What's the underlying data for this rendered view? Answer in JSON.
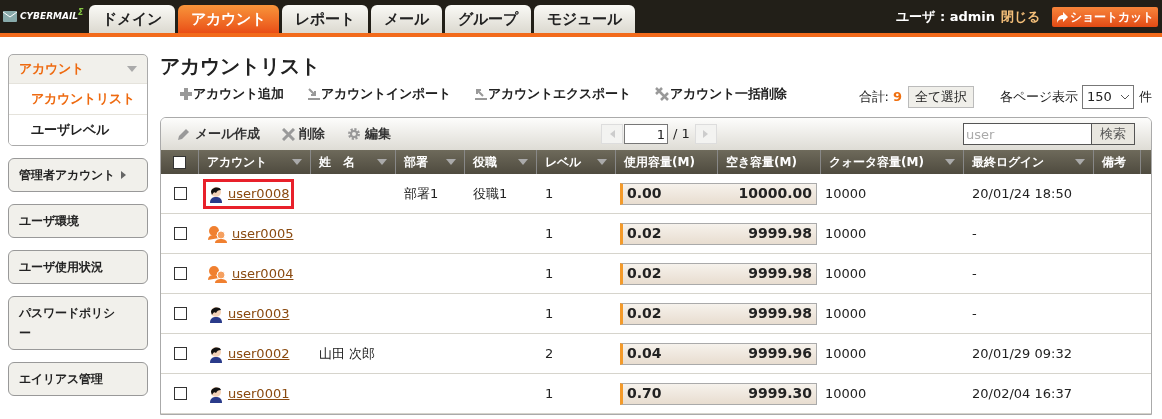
{
  "header": {
    "logo": "CYBERMAIL",
    "logo_mark": "Σ",
    "tabs": [
      {
        "label": "ドメイン",
        "selected": false
      },
      {
        "label": "アカウント",
        "selected": true
      },
      {
        "label": "レポート",
        "selected": false
      },
      {
        "label": "メール",
        "selected": false
      },
      {
        "label": "グループ",
        "selected": false
      },
      {
        "label": "モジュール",
        "selected": false
      }
    ],
    "user_label": "ユーザ : admin",
    "logout": "閉じる",
    "shortcut": "ショートカット"
  },
  "sidebar": [
    {
      "label": "アカウント",
      "kind": "open",
      "children": [
        {
          "label": "アカウントリスト",
          "selected": true
        },
        {
          "label": "ユーザレベル",
          "selected": false
        }
      ]
    },
    {
      "label": "管理者アカウント",
      "kind": "submenu"
    },
    {
      "label": "ユーザ環境",
      "kind": "plain"
    },
    {
      "label": "ユーザ使用状況",
      "kind": "plain"
    },
    {
      "label": "パスワードポリシー",
      "kind": "plain"
    },
    {
      "label": "エイリアス管理",
      "kind": "plain"
    }
  ],
  "title": "アカウントリスト",
  "actions": [
    {
      "label": "アカウント追加",
      "kind": "add"
    },
    {
      "label": "アカウントインポート",
      "kind": "import"
    },
    {
      "label": "アカウントエクスポート",
      "kind": "export"
    },
    {
      "label": "アカウント一括削除",
      "kind": "bulk"
    }
  ],
  "total_label": "合計:",
  "total": "9",
  "select_all": "全て選択",
  "per_page_label": "各ページ表示",
  "per_page": "150",
  "per_page_unit": "件",
  "toolbar": [
    {
      "label": "メール作成",
      "kind": "pencil"
    },
    {
      "label": "削除",
      "kind": "delete"
    },
    {
      "label": "編集",
      "kind": "gear"
    }
  ],
  "page": "1",
  "page_total": "/ 1",
  "search_value": "user",
  "search_button": "検索",
  "table": {
    "all_checked": false,
    "columns": [
      {
        "label": "アカウント",
        "sortable": true
      },
      {
        "label": "姓　名",
        "sortable": true
      },
      {
        "label": "部署",
        "sortable": true
      },
      {
        "label": "役職",
        "sortable": true
      },
      {
        "label": "レベル",
        "sortable": true
      },
      {
        "label": "使用容量(M)",
        "sortable": false
      },
      {
        "label": "空き容量(M)",
        "sortable": false
      },
      {
        "label": "クォータ容量(M)",
        "sortable": true
      },
      {
        "label": "最終ログイン",
        "sortable": true
      },
      {
        "label": "備考",
        "sortable": false
      }
    ],
    "rows": [
      {
        "checked": false,
        "kind": "user",
        "highlighted": true,
        "account": "user0008",
        "name": "",
        "dept": "部署1",
        "post": "役職1",
        "level_text": "1",
        "used": "0.00",
        "free": "10000.00",
        "quota": "10000",
        "last_login": "20/01/24 18:50"
      },
      {
        "checked": false,
        "kind": "group",
        "highlighted": false,
        "account": "user0005",
        "name": "",
        "dept": "",
        "post": "",
        "level_text": "1",
        "used": "0.02",
        "free": "9999.98",
        "quota": "10000",
        "last_login": "-"
      },
      {
        "checked": false,
        "kind": "group",
        "highlighted": false,
        "account": "user0004",
        "name": "",
        "dept": "",
        "post": "",
        "level_text": "1",
        "used": "0.02",
        "free": "9999.98",
        "quota": "10000",
        "last_login": "-"
      },
      {
        "checked": false,
        "kind": "user",
        "highlighted": false,
        "account": "user0003",
        "name": "",
        "dept": "",
        "post": "",
        "level_text": "1",
        "used": "0.02",
        "free": "9999.98",
        "quota": "10000",
        "last_login": "-"
      },
      {
        "checked": false,
        "kind": "user",
        "highlighted": false,
        "account": "user0002",
        "name": "山田 次郎",
        "dept": "",
        "post": "",
        "level_text": "2",
        "used": "0.04",
        "free": "9999.96",
        "quota": "10000",
        "last_login": "20/01/29 09:32"
      },
      {
        "checked": false,
        "kind": "user",
        "highlighted": false,
        "account": "user0001",
        "name": "",
        "dept": "",
        "post": "",
        "level_text": "1",
        "used": "0.70",
        "free": "9999.30",
        "quota": "10000",
        "last_login": "20/02/04 16:37"
      }
    ]
  }
}
